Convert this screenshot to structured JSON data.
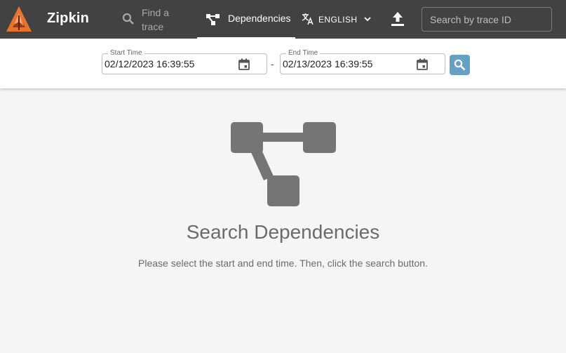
{
  "header": {
    "brand": "Zipkin",
    "nav": {
      "find_trace": "Find a trace",
      "dependencies": "Dependencies"
    },
    "language": "ENGLISH",
    "trace_search_placeholder": "Search by trace ID",
    "icons": {
      "logo": "zipkin-logo",
      "find": "search-icon",
      "dependencies": "dependency-graph-icon",
      "language": "translate-icon",
      "language_menu": "chevron-down-icon",
      "upload": "upload-icon"
    }
  },
  "filters": {
    "start_time": {
      "label": "Start Time",
      "value": "02/12/2023 16:39:55"
    },
    "separator": "-",
    "end_time": {
      "label": "End Time",
      "value": "02/13/2023 16:39:55"
    },
    "search_icon": "search-icon",
    "calendar_icon": "calendar-icon"
  },
  "empty_state": {
    "icon": "dependency-graph-icon",
    "title": "Search Dependencies",
    "subtitle": "Please select the start and end time. Then, click the search button."
  },
  "colors": {
    "appbar": "#424242",
    "accent": "#e8732c",
    "search_button": "#66a0c3",
    "empty_text": "#6b6b6b"
  }
}
